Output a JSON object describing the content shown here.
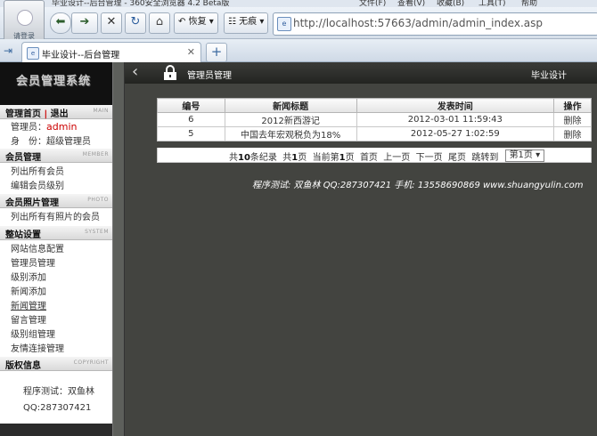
{
  "browser": {
    "title": "毕业设计--后台管理 - 360安全浏览器 4.2 Beta版",
    "menu": [
      "文件(F)",
      "查看(V)",
      "收藏(B)",
      "工具(T)",
      "帮助"
    ],
    "avatar_label": "请登录",
    "restore_label": "恢复",
    "no_trace_label": "无痕",
    "url": "http://localhost:57663/admin/admin_index.asp",
    "tab_title": "毕业设计--后台管理"
  },
  "sidebar": {
    "logo_text": "会员管理系统",
    "home_section": {
      "home": "管理首页",
      "sep": "|",
      "logout": "退出",
      "en": "MAIN"
    },
    "admin_label": "管理员：",
    "admin_name": "admin",
    "role_label": "身　份：",
    "role_value": "超级管理员",
    "member_section": {
      "title": "会员管理",
      "en": "MEMBER",
      "items": [
        "列出所有会员",
        "编辑会员级别"
      ]
    },
    "photo_section": {
      "title": "会员照片管理",
      "en": "PHOTO",
      "items": [
        "列出所有有照片的会员"
      ]
    },
    "system_section": {
      "title": "整站设置",
      "en": "SYSTEM",
      "items": [
        "网站信息配置",
        "管理员管理",
        "级别添加",
        "新闻添加",
        "新闻管理",
        "留言管理",
        "级别组管理",
        "友情连接管理"
      ]
    },
    "copyright_section": {
      "title": "版权信息",
      "en": "COPYRIGHT",
      "tester": "程序测试：双鱼林",
      "qq": "QQ:287307421"
    }
  },
  "main": {
    "header_title": "管理员管理",
    "header_right": "毕业设计",
    "table": {
      "columns": [
        "编号",
        "新闻标题",
        "发表时间",
        "操作"
      ],
      "rows": [
        {
          "id": "6",
          "title": "2012新西游记",
          "time": "2012-03-01 11:59:43",
          "action": "删除"
        },
        {
          "id": "5",
          "title": "中国去年宏观税负为18%",
          "time": "2012-05-27 1:02:59",
          "action": "删除"
        }
      ]
    },
    "pager": {
      "total_pre": "共",
      "total": "10",
      "total_post": "条纪录",
      "pages_pre": "共",
      "pages": "1",
      "pages_post": "页",
      "current_pre": "当前第",
      "current": "1",
      "current_post": "页",
      "first": "首页",
      "prev": "上一页",
      "next": "下一页",
      "last": "尾页",
      "jump": "跳转到",
      "jump_value": "第1页"
    },
    "footer": "程序测试: 双鱼林   QQ:287307421   手机: 13558690869 www.shuangyulin.com"
  }
}
